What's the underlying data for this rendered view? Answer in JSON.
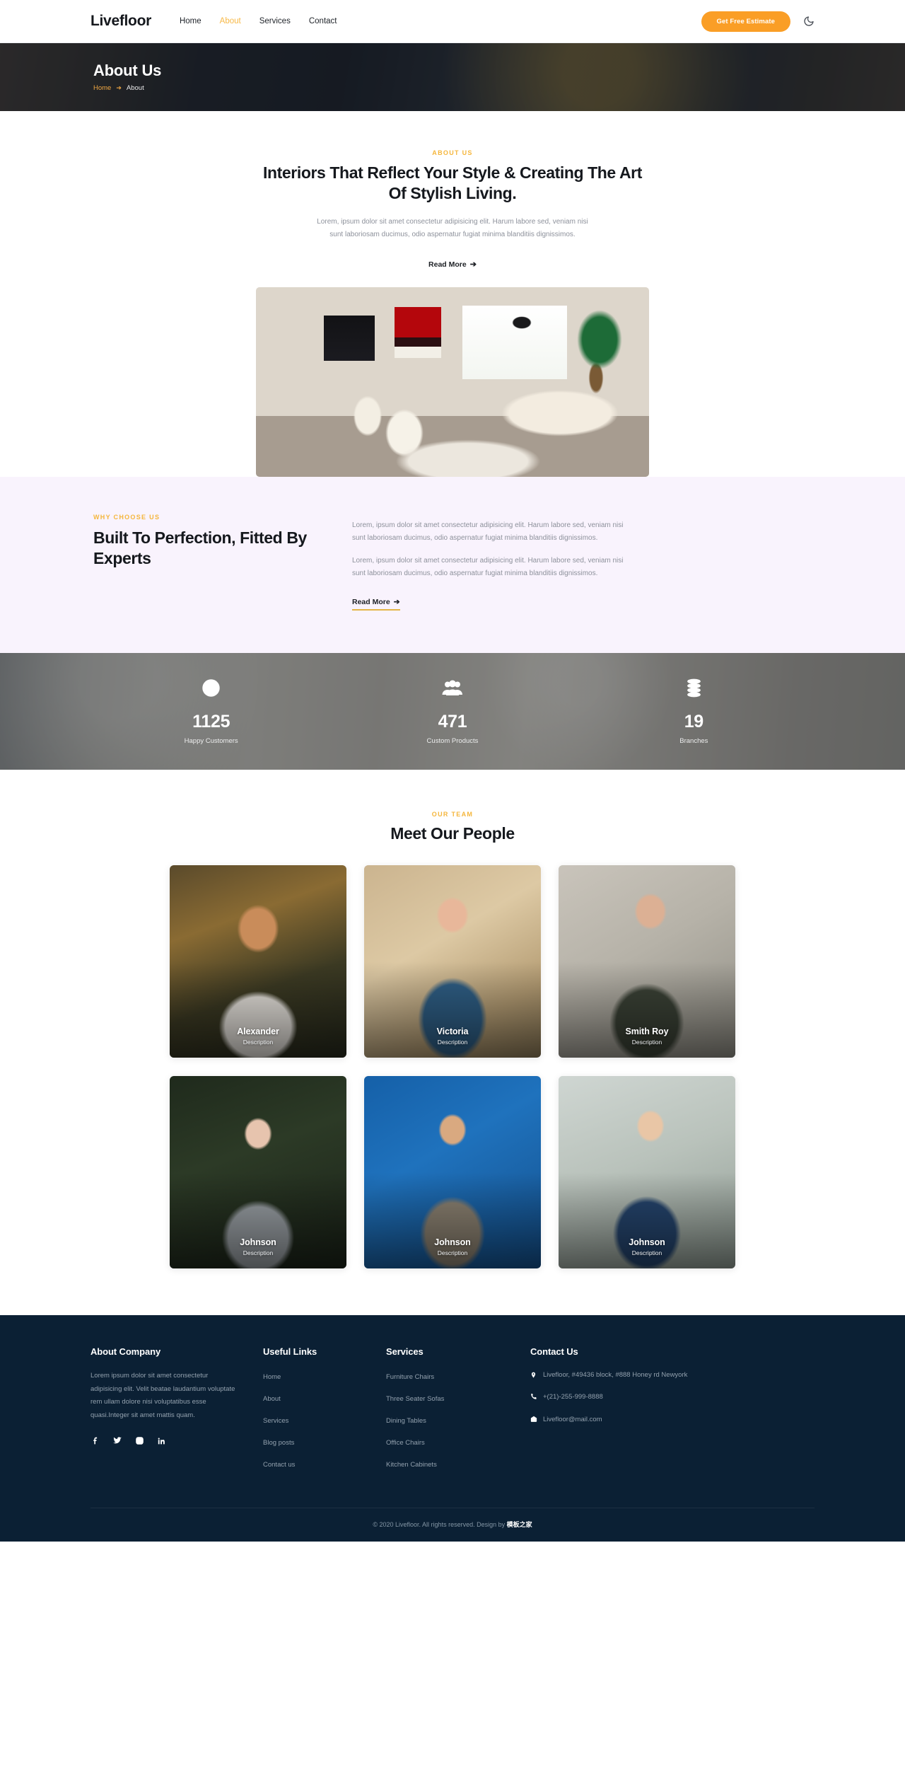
{
  "header": {
    "brand": "Livefloor",
    "nav": [
      {
        "label": "Home",
        "active": false
      },
      {
        "label": "About",
        "active": true
      },
      {
        "label": "Services",
        "active": false
      },
      {
        "label": "Contact",
        "active": false
      }
    ],
    "cta_label": "Get Free Estimate",
    "theme_toggle_icon": "moon-icon",
    "accent_color": "#fa9e26"
  },
  "banner": {
    "title": "About Us",
    "breadcrumb_home": "Home",
    "breadcrumb_separator": "➔",
    "breadcrumb_current": "About"
  },
  "about": {
    "eyebrow": "ABOUT US",
    "heading": "Interiors That Reflect Your Style & Creating The Art Of Stylish Living.",
    "paragraph": "Lorem, ipsum dolor sit amet consectetur adipisicing elit. Harum labore sed, veniam nisi sunt laboriosam ducimus, odio aspernatur fugiat minima blanditiis dignissimos.",
    "read_more": "Read More",
    "arrow": "➔",
    "image_alt": "living-room-interior-photo"
  },
  "why": {
    "eyebrow": "WHY CHOOSE US",
    "heading": "Built To Perfection, Fitted By Experts",
    "paragraph_1": "Lorem, ipsum dolor sit amet consectetur adipisicing elit. Harum labore sed, veniam nisi sunt laboriosam ducimus, odio aspernatur fugiat minima blanditiis dignissimos.",
    "paragraph_2": "Lorem, ipsum dolor sit amet consectetur adipisicing elit. Harum labore sed, veniam nisi sunt laboriosam ducimus, odio aspernatur fugiat minima blanditiis dignissimos.",
    "read_more": "Read More",
    "arrow": "➔",
    "background_color": "#f9f3fd"
  },
  "counters": [
    {
      "icon": "smiley-icon",
      "value": "1125",
      "label": "Happy Customers"
    },
    {
      "icon": "people-icon",
      "value": "471",
      "label": "Custom Products"
    },
    {
      "icon": "database-stack-icon",
      "value": "19",
      "label": "Branches"
    }
  ],
  "team": {
    "eyebrow": "OUR TEAM",
    "heading": "Meet Our People",
    "members": [
      {
        "name": "Alexander",
        "desc": "Description"
      },
      {
        "name": "Victoria",
        "desc": "Description"
      },
      {
        "name": "Smith Roy",
        "desc": "Description"
      },
      {
        "name": "Johnson",
        "desc": "Description"
      },
      {
        "name": "Johnson",
        "desc": "Description"
      },
      {
        "name": "Johnson",
        "desc": "Description"
      }
    ]
  },
  "footer": {
    "about": {
      "title": "About Company",
      "text": "Lorem ipsum dolor sit amet consectetur adipisicing elit. Velit beatae laudantium voluptate rem ullam dolore nisi voluptatibus esse quasi.Integer sit amet mattis quam.",
      "socials": [
        "facebook-icon",
        "twitter-icon",
        "instagram-icon",
        "linkedin-icon"
      ]
    },
    "useful_links": {
      "title": "Useful Links",
      "items": [
        "Home",
        "About",
        "Services",
        "Blog posts",
        "Contact us"
      ]
    },
    "services": {
      "title": "Services",
      "items": [
        "Furniture Chairs",
        "Three Seater Sofas",
        "Dining Tables",
        "Office Chairs",
        "Kitchen Cabinets"
      ]
    },
    "contact": {
      "title": "Contact Us",
      "address": "Livefloor, #49436 block, #888 Honey rd Newyork",
      "phone": "+(21)-255-999-8888",
      "email": "Livefloor@mail.com"
    },
    "copyright_text": "© 2020 Livefloor. All rights reserved. Design by ",
    "copyright_credit": "模板之家",
    "background_color": "#0b2034"
  }
}
